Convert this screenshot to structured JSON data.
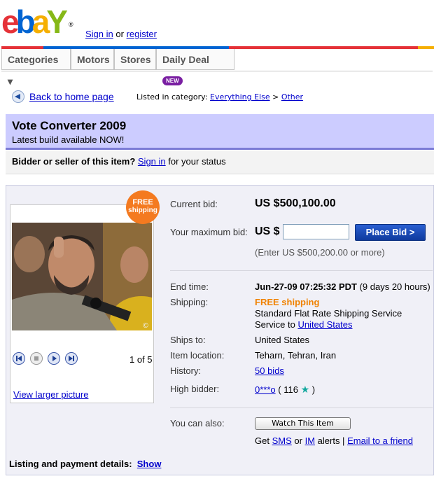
{
  "header": {
    "logo": {
      "e": "e",
      "b": "b",
      "a": "a",
      "y": "Y",
      "reg": "®"
    },
    "sign_in": "Sign in",
    "or": "or",
    "register": "register"
  },
  "nav": {
    "tabs": [
      "Categories ▾",
      "Motors",
      "Stores",
      "Daily Deal"
    ],
    "new_badge": "NEW"
  },
  "breadcrumb": {
    "back": "Back to home page",
    "listed_in": "Listed in category:",
    "category": "Everything Else",
    "sep": ">",
    "subcategory": "Other"
  },
  "item": {
    "title": "Vote Converter 2009",
    "subtitle": "Latest build available NOW!"
  },
  "bidder_status": {
    "question": "Bidder or seller of this item?",
    "sign_in": "Sign in",
    "suffix": "for your status"
  },
  "gallery": {
    "badge_line1": "FREE",
    "badge_line2": "shipping",
    "page_count": "1 of 5",
    "view_larger": "View larger picture"
  },
  "bid": {
    "current_label": "Current bid:",
    "current_value": "US $500,100.00",
    "max_label": "Your maximum bid:",
    "currency": "US $",
    "input_value": "",
    "place_bid": "Place Bid >",
    "hint": "(Enter US $500,200.00 or more)"
  },
  "details": {
    "end_time_label": "End time:",
    "end_time_value": "Jun-27-09 07:25:32 PDT",
    "end_time_left": "(9 days 20 hours)",
    "shipping_label": "Shipping:",
    "shipping_free": "FREE shipping",
    "shipping_service": "Standard Flat Rate Shipping Service",
    "service_to": "Service to",
    "service_country": "United States",
    "ships_to_label": "Ships to:",
    "ships_to_value": "United States",
    "location_label": "Item location:",
    "location_value": "Teharn, Tehran, Iran",
    "history_label": "History:",
    "history_value": "50 bids",
    "high_bidder_label": "High bidder:",
    "high_bidder_name": "0***o",
    "high_bidder_score_open": "( 116",
    "high_bidder_score_close": ")"
  },
  "actions": {
    "also_label": "You can also:",
    "watch": "Watch This Item",
    "get": "Get",
    "sms": "SMS",
    "or": "or",
    "im": "IM",
    "alerts": "alerts |",
    "email": "Email to a friend"
  },
  "listing": {
    "label": "Listing and payment details:",
    "show": "Show"
  },
  "colors": {
    "title_bg": "#ccccff",
    "accent_blue": "#0f3a9e",
    "shipping_orange": "#f08200"
  }
}
